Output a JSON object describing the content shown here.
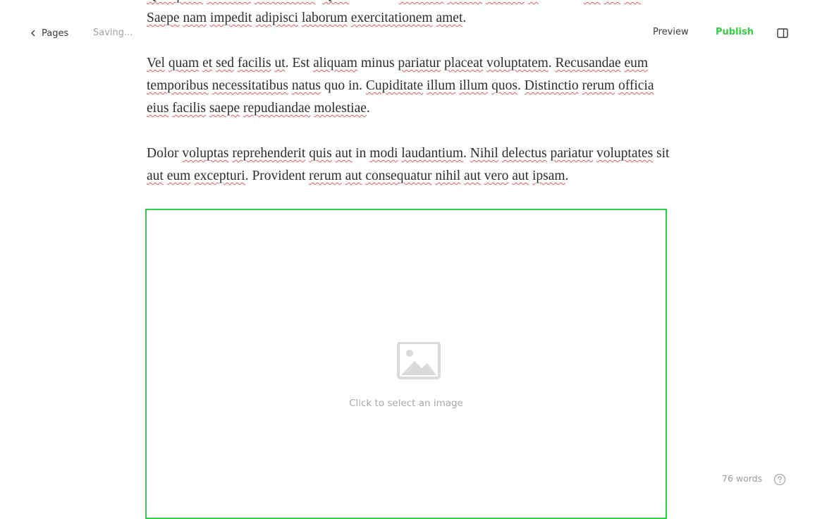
{
  "header": {
    "back_label": "Pages",
    "status": "Saving...",
    "preview_label": "Preview",
    "publish_label": "Publish",
    "accent_color": "#30cf43"
  },
  "editor": {
    "paragraphs": [
      [
        [
          "Quisquam",
          1
        ],
        [
          " ",
          0
        ],
        [
          "veritatis",
          1
        ],
        [
          " ",
          0
        ],
        [
          "recusandae",
          1
        ],
        [
          ". ",
          0
        ],
        [
          "Quia",
          1
        ],
        [
          " nihilum ",
          0
        ],
        [
          "nostrum",
          1
        ],
        [
          " ",
          0
        ],
        [
          "dolore",
          1
        ],
        [
          " ",
          0
        ],
        [
          "officiis",
          1
        ],
        [
          " ",
          0
        ],
        [
          "ut",
          1
        ],
        [
          " dictum ",
          0
        ],
        [
          "aut",
          1
        ],
        [
          " ",
          0
        ],
        [
          "aut",
          1
        ],
        [
          " ",
          0
        ],
        [
          "aut",
          1
        ],
        [
          ". ",
          0
        ],
        [
          "Saepe",
          1
        ],
        [
          " ",
          0
        ],
        [
          "nam",
          1
        ],
        [
          " ",
          0
        ],
        [
          "impedit",
          1
        ],
        [
          " ",
          0
        ],
        [
          "adipisci",
          1
        ],
        [
          " ",
          0
        ],
        [
          "laborum",
          1
        ],
        [
          " ",
          0
        ],
        [
          "exercitationem",
          1
        ],
        [
          " ",
          0
        ],
        [
          "amet",
          1
        ],
        [
          ".",
          0
        ]
      ],
      [
        [
          "Vel",
          1
        ],
        [
          " ",
          0
        ],
        [
          "quam",
          1
        ],
        [
          " ",
          0
        ],
        [
          "et",
          1
        ],
        [
          " ",
          0
        ],
        [
          "sed",
          1
        ],
        [
          " ",
          0
        ],
        [
          "facilis",
          1
        ],
        [
          " ",
          0
        ],
        [
          "ut",
          1
        ],
        [
          ". Est ",
          0
        ],
        [
          "aliquam",
          1
        ],
        [
          " minus ",
          0
        ],
        [
          "pariatur",
          1
        ],
        [
          " ",
          0
        ],
        [
          "placeat",
          1
        ],
        [
          " ",
          0
        ],
        [
          "voluptatem",
          1
        ],
        [
          ". ",
          0
        ],
        [
          "Recusandae",
          1
        ],
        [
          " ",
          0
        ],
        [
          "eum",
          1
        ],
        [
          " ",
          0
        ],
        [
          "temporibus",
          1
        ],
        [
          " ",
          0
        ],
        [
          "necessitatibus",
          1
        ],
        [
          " ",
          0
        ],
        [
          "natus",
          1
        ],
        [
          " quo in. ",
          0
        ],
        [
          "Cupiditate",
          1
        ],
        [
          " ",
          0
        ],
        [
          "illum",
          1
        ],
        [
          " ",
          0
        ],
        [
          "illum",
          1
        ],
        [
          " ",
          0
        ],
        [
          "quos",
          1
        ],
        [
          ". ",
          0
        ],
        [
          "Distinctio",
          1
        ],
        [
          " ",
          0
        ],
        [
          "rerum",
          1
        ],
        [
          " ",
          0
        ],
        [
          "officia",
          1
        ],
        [
          " ",
          0
        ],
        [
          "eius",
          1
        ],
        [
          " ",
          0
        ],
        [
          "facilis",
          1
        ],
        [
          " ",
          0
        ],
        [
          "saepe",
          1
        ],
        [
          " ",
          0
        ],
        [
          "repudiandae",
          1
        ],
        [
          " ",
          0
        ],
        [
          "molestiae",
          1
        ],
        [
          ".",
          0
        ]
      ],
      [
        [
          "Dolor ",
          0
        ],
        [
          "voluptas",
          1
        ],
        [
          " ",
          0
        ],
        [
          "reprehenderit",
          1
        ],
        [
          " ",
          0
        ],
        [
          "quis",
          1
        ],
        [
          " ",
          0
        ],
        [
          "aut",
          1
        ],
        [
          " in ",
          0
        ],
        [
          "modi",
          1
        ],
        [
          " ",
          0
        ],
        [
          "laudantium",
          1
        ],
        [
          ". ",
          0
        ],
        [
          "Nihil",
          1
        ],
        [
          " ",
          0
        ],
        [
          "delectus",
          1
        ],
        [
          " ",
          0
        ],
        [
          "pariatur",
          1
        ],
        [
          " ",
          0
        ],
        [
          "voluptates",
          1
        ],
        [
          " sit ",
          0
        ],
        [
          "aut",
          1
        ],
        [
          " ",
          0
        ],
        [
          "eum",
          1
        ],
        [
          " ",
          0
        ],
        [
          "excepturi",
          1
        ],
        [
          ". Provident ",
          0
        ],
        [
          "rerum",
          1
        ],
        [
          " ",
          0
        ],
        [
          "aut",
          1
        ],
        [
          " ",
          0
        ],
        [
          "consequatur",
          1
        ],
        [
          " ",
          0
        ],
        [
          "nihil",
          1
        ],
        [
          " ",
          0
        ],
        [
          "aut",
          1
        ],
        [
          " ",
          0
        ],
        [
          "vero",
          1
        ],
        [
          " ",
          0
        ],
        [
          "aut",
          1
        ],
        [
          " ",
          0
        ],
        [
          "ipsam",
          1
        ],
        [
          ".",
          0
        ]
      ]
    ]
  },
  "image_block": {
    "caption": "Click to select an image",
    "icon": "image-placeholder-icon"
  },
  "footer": {
    "word_count": "76 words",
    "help_icon": "help-circle-icon"
  }
}
